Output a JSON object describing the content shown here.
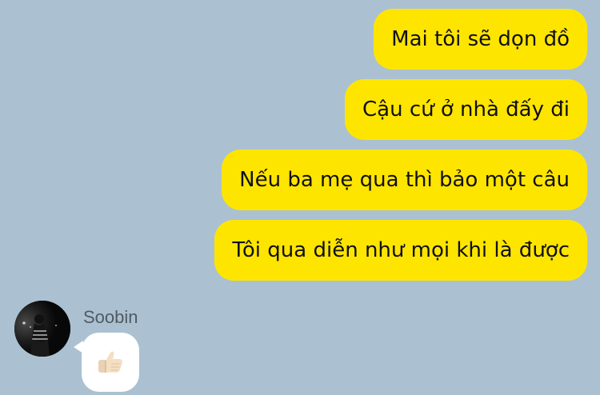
{
  "chat": {
    "outgoing_messages": [
      {
        "text": "Mai tôi sẽ dọn đồ"
      },
      {
        "text": "Cậu cứ ở nhà đấy đi"
      },
      {
        "text": "Nếu ba mẹ qua thì bảo một câu"
      },
      {
        "text": "Tôi qua diễn như mọi khi là được"
      }
    ],
    "incoming_message": {
      "sender_name": "Soobin",
      "emoji": "thumbs-up-icon"
    }
  },
  "colors": {
    "background": "#abc1d1",
    "outgoing_bubble": "#fee500",
    "incoming_bubble": "#ffffff",
    "sender_name_text": "#505a63"
  }
}
